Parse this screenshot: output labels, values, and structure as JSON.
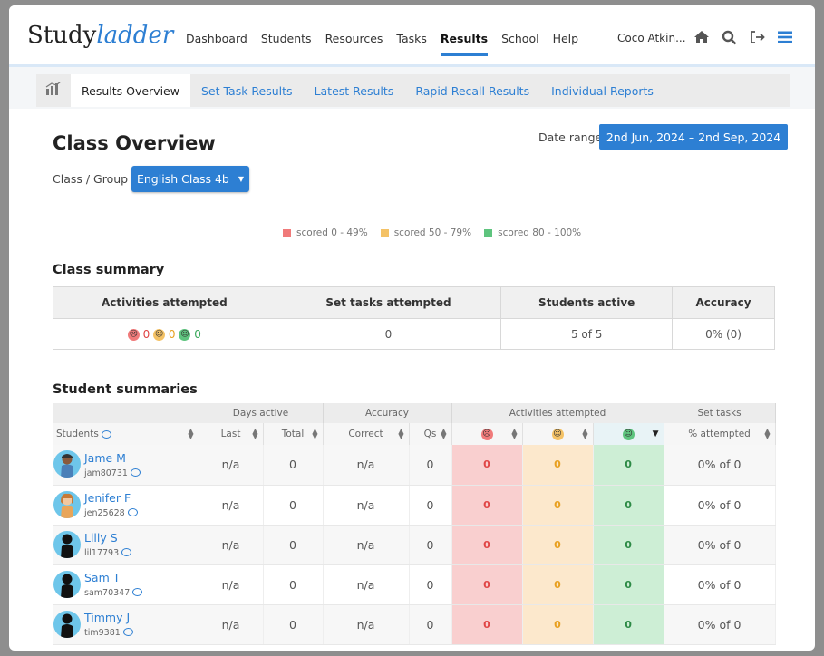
{
  "brand": {
    "part1": "Study",
    "part2": "ladder"
  },
  "nav": [
    "Dashboard",
    "Students",
    "Resources",
    "Tasks",
    "Results",
    "School",
    "Help"
  ],
  "user": "Coco Atkin...",
  "subnav": [
    "Results Overview",
    "Set Task Results",
    "Latest Results",
    "Rapid Recall Results",
    "Individual Reports"
  ],
  "page_title": "Class Overview",
  "date_range": {
    "label": "Date range",
    "value": "2nd Jun, 2024 – 2nd Sep, 2024"
  },
  "class_group": {
    "label": "Class / Group",
    "value": "English Class 4b"
  },
  "legend": [
    "scored 0 - 49%",
    "scored 50 - 79%",
    "scored 80 - 100%"
  ],
  "colors": {
    "accent": "#2d7fd3",
    "red": "#f07a7a",
    "amber": "#f4c266",
    "green": "#5ec47e"
  },
  "class_summary": {
    "title": "Class summary",
    "headers": [
      "Activities attempted",
      "Set tasks attempted",
      "Students active",
      "Accuracy"
    ],
    "activities": [
      "0",
      "0",
      "0"
    ],
    "set_tasks": "0",
    "students_active": "5 of 5",
    "accuracy": "0% (0)"
  },
  "student_summaries": {
    "title": "Student summaries",
    "groups": [
      "Days active",
      "Accuracy",
      "Activities attempted",
      "Set tasks"
    ],
    "columns": {
      "students": "Students",
      "last": "Last",
      "total": "Total",
      "correct": "Correct",
      "qs": "Qs",
      "attempted": "% attempted"
    },
    "rows": [
      {
        "name": "Jame M",
        "id": "jam80731",
        "last": "n/a",
        "total": "0",
        "correct": "n/a",
        "qs": "0",
        "red": "0",
        "amber": "0",
        "green": "0",
        "set": "0% of 0"
      },
      {
        "name": "Jenifer F",
        "id": "jen25628",
        "last": "n/a",
        "total": "0",
        "correct": "n/a",
        "qs": "0",
        "red": "0",
        "amber": "0",
        "green": "0",
        "set": "0% of 0"
      },
      {
        "name": "Lilly S",
        "id": "lil17793",
        "last": "n/a",
        "total": "0",
        "correct": "n/a",
        "qs": "0",
        "red": "0",
        "amber": "0",
        "green": "0",
        "set": "0% of 0"
      },
      {
        "name": "Sam T",
        "id": "sam70347",
        "last": "n/a",
        "total": "0",
        "correct": "n/a",
        "qs": "0",
        "red": "0",
        "amber": "0",
        "green": "0",
        "set": "0% of 0"
      },
      {
        "name": "Timmy J",
        "id": "tim9381",
        "last": "n/a",
        "total": "0",
        "correct": "n/a",
        "qs": "0",
        "red": "0",
        "amber": "0",
        "green": "0",
        "set": "0% of 0"
      }
    ]
  }
}
